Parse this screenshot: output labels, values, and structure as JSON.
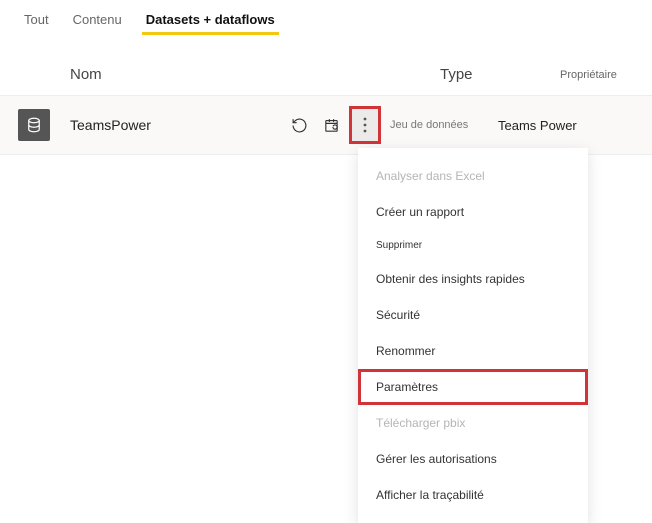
{
  "tabs": {
    "all": "Tout",
    "content": "Contenu",
    "datasets": "Datasets + dataflows"
  },
  "columns": {
    "name": "Nom",
    "type": "Type",
    "owner": "Propriétaire"
  },
  "row": {
    "name": "TeamsPower",
    "type": "Jeu de données",
    "owner": "Teams Power"
  },
  "menu": {
    "analyze_excel": "Analyser dans Excel",
    "create_report": "Créer un rapport",
    "delete": "Supprimer",
    "quick_insights": "Obtenir des insights rapides",
    "security": "Sécurité",
    "rename": "Renommer",
    "settings": "Paramètres",
    "download_pbix": "Télécharger pbix",
    "manage_permissions": "Gérer les autorisations",
    "view_lineage": "Afficher la traçabilité"
  }
}
